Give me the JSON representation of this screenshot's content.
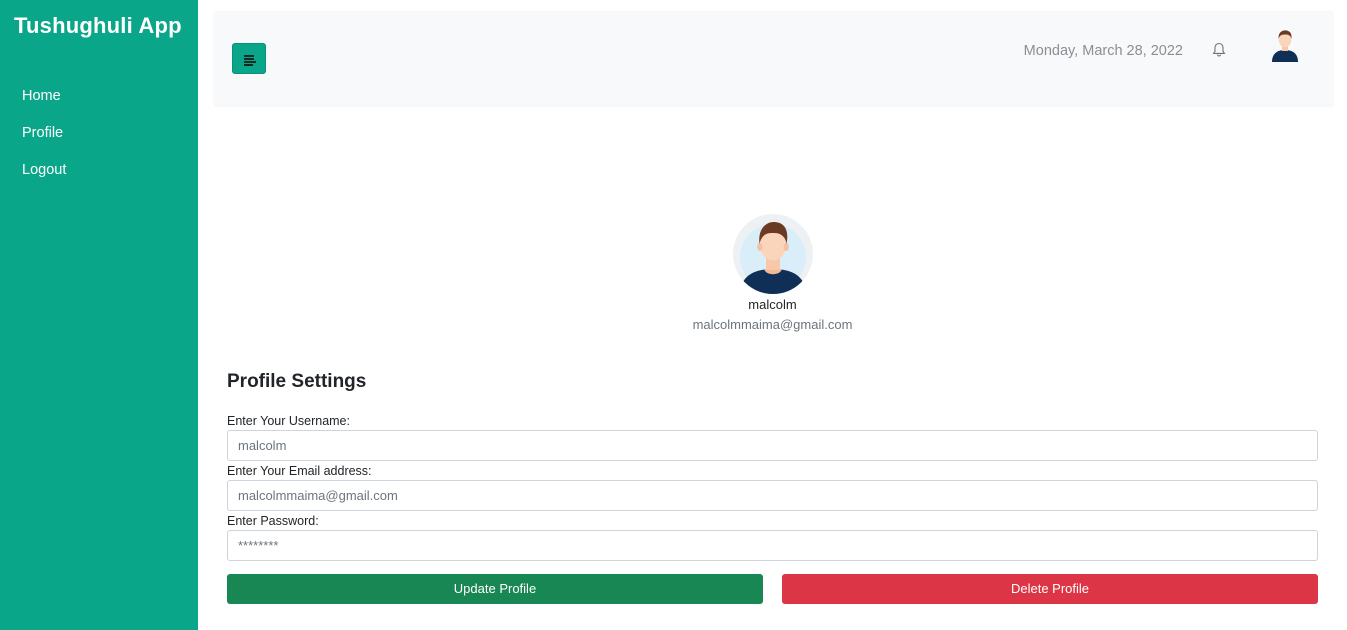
{
  "sidebar": {
    "brand": "Tushughuli App",
    "items": [
      {
        "label": "Home"
      },
      {
        "label": "Profile"
      },
      {
        "label": "Logout"
      }
    ]
  },
  "header": {
    "menu_icon": "menu-lines-icon",
    "date": "Monday, March 28, 2022",
    "bell_icon": "bell-icon",
    "avatar_icon": "user-avatar-icon"
  },
  "profile": {
    "name": "malcolm",
    "email": "malcolmmaima@gmail.com"
  },
  "settings": {
    "title": "Profile Settings",
    "username_label": "Enter Your Username:",
    "username_placeholder": "malcolm",
    "email_label": "Enter Your Email address:",
    "email_placeholder": "malcolmmaima@gmail.com",
    "password_label": "Enter Password:",
    "password_placeholder": "********",
    "update_label": "Update Profile",
    "delete_label": "Delete Profile"
  },
  "colors": {
    "sidebar": "#0aa689",
    "update": "#198754",
    "delete": "#dc3545"
  }
}
